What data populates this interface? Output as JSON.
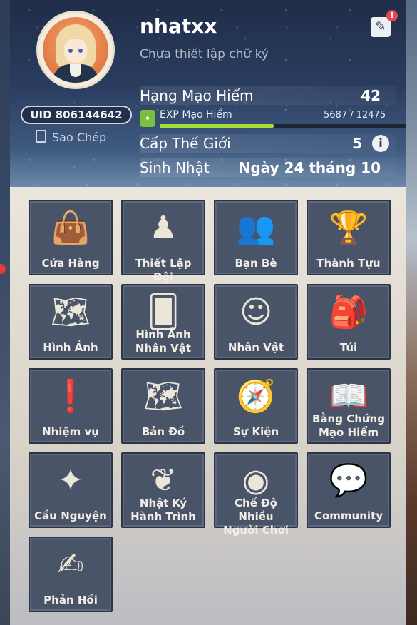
{
  "profile": {
    "name": "nhatxx",
    "signature": "Chưa thiết lập chữ ký",
    "uid": "UID 806144642",
    "copy_label": "Sao Chép",
    "edit_badge": "!"
  },
  "stats": {
    "adventure_rank_label": "Hạng Mạo Hiểm",
    "adventure_rank_value": "42",
    "exp_label": "EXP Mạo Hiểm",
    "exp_value": "5687 / 12475",
    "exp_fraction": 0.456,
    "world_level_label": "Cấp Thế Giới",
    "world_level_value": "5",
    "birthday_label": "Sinh Nhật",
    "birthday_value": "Ngày 24 tháng 10"
  },
  "menu": [
    {
      "label": "Cửa Hàng",
      "icon": "shop-bag-icon"
    },
    {
      "label": "Thiết Lập Đội",
      "icon": "party-setup-icon"
    },
    {
      "label": "Bạn Bè",
      "icon": "friends-icon"
    },
    {
      "label": "Thành Tựu",
      "icon": "achievement-trophy-icon"
    },
    {
      "label": "Hình Ảnh",
      "icon": "namecard-icon"
    },
    {
      "label": "Hình Ảnh\nNhân Vật",
      "icon": "character-archive-icon"
    },
    {
      "label": "Nhân Vật",
      "icon": "character-icon"
    },
    {
      "label": "Túi",
      "icon": "backpack-icon"
    },
    {
      "label": "Nhiệm vụ",
      "icon": "quest-banner-icon"
    },
    {
      "label": "Bản Đồ",
      "icon": "map-icon"
    },
    {
      "label": "Sự Kiện",
      "icon": "event-compass-icon"
    },
    {
      "label": "Bằng Chứng\nMạo Hiểm",
      "icon": "handbook-icon"
    },
    {
      "label": "Cầu Nguyện",
      "icon": "wish-star-icon"
    },
    {
      "label": "Nhật Ký\nHành Trình",
      "icon": "battle-pass-icon"
    },
    {
      "label": "Chế Độ Nhiều\nNgười Chơi",
      "icon": "coop-icon"
    },
    {
      "label": "Community",
      "icon": "community-chat-icon"
    },
    {
      "label": "Phản Hồi",
      "icon": "feedback-icon"
    }
  ]
}
